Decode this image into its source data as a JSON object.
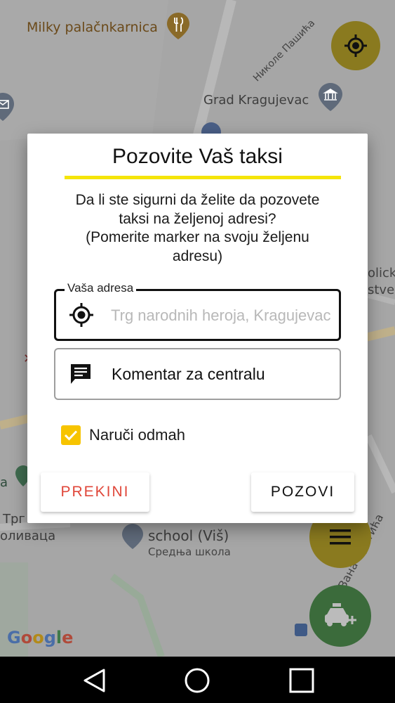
{
  "map": {
    "labels": {
      "milky": "Milky palačnkarnica",
      "nikole": "Николе Пашића",
      "grad": "Grad Kragujevac",
      "school": "school (Viš)",
      "srednja": "Средња школа",
      "trg": "Трг",
      "olivaca": "оливаца",
      "proticha": "Вана Протића",
      "policki": "olicki",
      "stver": "stver"
    },
    "google_logo": "Google",
    "colors": {
      "map_bg": "#a6a6a6",
      "fab_yellow": "#8a7a1f",
      "fab_green": "#3b6b3b"
    },
    "icons": {
      "locate": "crosshair-icon",
      "menu": "hamburger-menu-icon",
      "taxi": "add-taxi-icon"
    }
  },
  "dialog": {
    "title": "Pozovite Vaš taksi",
    "message": [
      "Da li ste sigurni da želite da pozovete",
      "taksi na željenoj adresi?",
      "(Pomerite marker na svoju željenu",
      "adresu)"
    ],
    "address": {
      "legend": "Vaša adresa",
      "value": "",
      "placeholder": "Trg narodnih heroja, Kragujevac"
    },
    "comment": {
      "label": "Komentar za centralu"
    },
    "order_now": {
      "label": "Naruči odmah",
      "checked": true
    },
    "buttons": {
      "cancel": "PREKINI",
      "call": "POZOVI"
    },
    "colors": {
      "accent_yellow": "#f5e50a",
      "checkbox": "#f7c400",
      "cancel_red": "#e0473a"
    }
  },
  "navbar": {
    "icons": {
      "back": "back-triangle-icon",
      "home": "home-circle-icon",
      "recents": "recents-square-icon"
    }
  }
}
